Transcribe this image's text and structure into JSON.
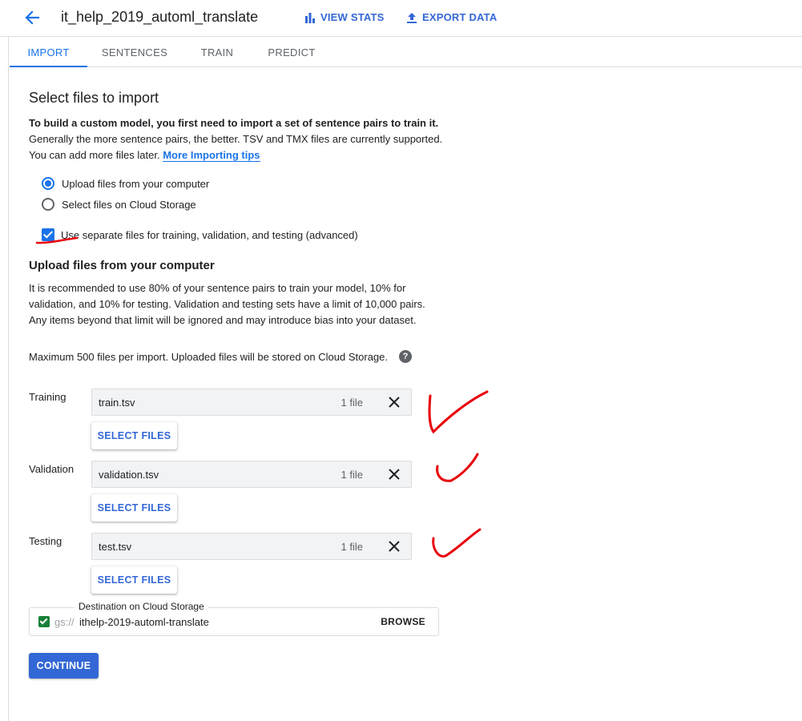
{
  "header": {
    "title": "it_help_2019_automl_translate",
    "view_stats": "VIEW STATS",
    "export_data": "EXPORT DATA"
  },
  "tabs": [
    {
      "label": "IMPORT",
      "active": true
    },
    {
      "label": "SENTENCES",
      "active": false
    },
    {
      "label": "TRAIN",
      "active": false
    },
    {
      "label": "PREDICT",
      "active": false
    }
  ],
  "import": {
    "heading": "Select files to import",
    "intro_bold": "To build a custom model, you first need to import a set of sentence pairs to train it.",
    "intro_line2": "Generally the more sentence pairs, the better. TSV and TMX files are currently supported.",
    "intro_line3": "You can add more files later.",
    "tips_link": "More Importing tips",
    "source_options": [
      {
        "label": "Upload files from your computer",
        "selected": true
      },
      {
        "label": "Select files on Cloud Storage",
        "selected": false
      }
    ],
    "separate_files": {
      "label": "Use separate files for training, validation, and testing (advanced)",
      "checked": true
    }
  },
  "upload": {
    "heading": "Upload files from your computer",
    "description": "It is recommended to use 80% of your sentence pairs to train your model, 10% for validation, and 10% for testing. Validation and testing sets have a limit of 10,000 pairs. Any items beyond that limit will be ignored and may introduce bias into your dataset.",
    "max_files": "Maximum 500 files per import. Uploaded files will be stored on Cloud Storage.",
    "help_icon": "help-icon",
    "select_files_label": "SELECT FILES",
    "fields": {
      "training": {
        "label": "Training",
        "file": "train.tsv",
        "count": "1 file"
      },
      "validation": {
        "label": "Validation",
        "file": "validation.tsv",
        "count": "1 file"
      },
      "testing": {
        "label": "Testing",
        "file": "test.tsv",
        "count": "1 file"
      }
    }
  },
  "destination": {
    "legend": "Destination on Cloud Storage",
    "prefix": "gs://",
    "bucket": "ithelp-2019-automl-translate",
    "browse": "BROWSE"
  },
  "continue_label": "CONTINUE",
  "annotation_color": "#e8000b"
}
